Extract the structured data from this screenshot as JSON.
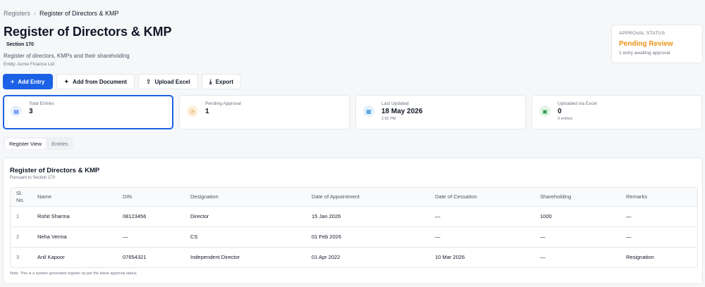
{
  "breadcrumb": {
    "parent": "Registers",
    "separator": "›",
    "current": "Register of Directors & KMP"
  },
  "header": {
    "title": "Register of Directors & KMP",
    "section_badge": "Section 170",
    "subtitle": "Register of directors, KMPs and their shareholding",
    "entity": "Entity: Acme Finance Ltd"
  },
  "approval": {
    "label": "APPROVAL STATUS",
    "status": "Pending Review",
    "note": "1 entry awaiting approval",
    "status_color": "#ea9216"
  },
  "toolbar": {
    "add_entry": "Add Entry",
    "add_from_document": "Add from Document",
    "upload_excel": "Upload Excel",
    "export": "Export"
  },
  "stats": [
    {
      "title": "Total Entries",
      "value": "3",
      "sub": "",
      "icon": "clipboard-icon"
    },
    {
      "title": "Pending Approval",
      "value": "1",
      "sub": "",
      "icon": "clock-icon"
    },
    {
      "title": "Last Updated",
      "value": "18 May 2026",
      "sub": "1:52 PM",
      "icon": "calendar-icon"
    },
    {
      "title": "Uploaded via Excel",
      "value": "0",
      "sub": "0 entries",
      "icon": "excel-file-icon"
    }
  ],
  "tabs": [
    {
      "label": "Register View",
      "active": true
    },
    {
      "label": "Entries",
      "active": false
    }
  ],
  "register": {
    "title": "Register of Directors & KMP",
    "subtitle": "Pursuant to Section 170",
    "columns": [
      "Sl. No.",
      "Name",
      "DIN",
      "Designation",
      "Date of Appointment",
      "Date of Cessation",
      "Shareholding",
      "Remarks"
    ],
    "rows": [
      [
        "1",
        "Rohit Sharma",
        "08123456",
        "Director",
        "15 Jan 2026",
        "—",
        "1000",
        "—"
      ],
      [
        "2",
        "Neha Verma",
        "—",
        "CS",
        "01 Feb 2026",
        "—",
        "—",
        "—"
      ],
      [
        "3",
        "Anil Kapoor",
        "07654321",
        "Independent Director",
        "01 Apr 2022",
        "10 Mar 2026",
        "—",
        "Resignation"
      ]
    ],
    "footnote": "Note: This is a system generated register as per the latest approval status."
  },
  "colors": {
    "primary": "#1d62e6",
    "pending": "#ea9216"
  }
}
